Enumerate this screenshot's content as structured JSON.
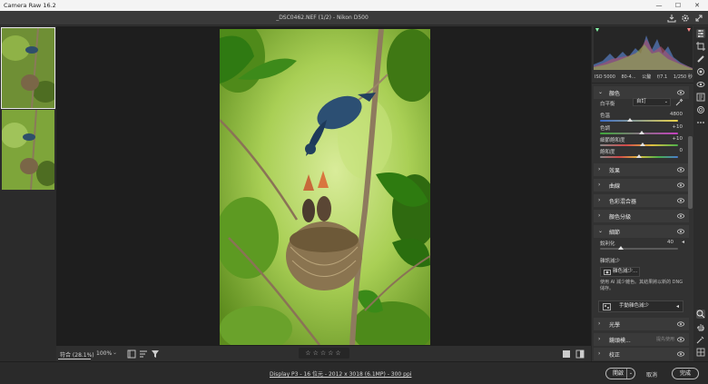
{
  "window": {
    "title": "Camera Raw 16.2",
    "minimize": "—",
    "maximize": "☐",
    "close": "✕"
  },
  "header": {
    "file_title": "_DSC0462.NEF (1/2)  -  Nikon D500"
  },
  "bottom_toolbar": {
    "zoom_fit": "符合 (28.1%)",
    "zoom_100": "100%",
    "zoom_caret": "⌄",
    "rating_stars": "☆☆☆☆☆"
  },
  "exif": {
    "iso": "ISO 5000",
    "lens": "80-4...",
    "focal": "公釐",
    "aperture": "f/7.1",
    "shutter": "1/250 秒"
  },
  "panels": {
    "color": {
      "title": "顏色",
      "white_balance_label": "白平衡",
      "white_balance_value": "自訂",
      "temperature_label": "色溫",
      "temperature_value": "4800",
      "temperature_level": 0.38,
      "tint_label": "色調",
      "tint_value": "+10",
      "tint_level": 0.53,
      "vibrance_label": "細節飽和度",
      "vibrance_value": "+10",
      "vibrance_level": 0.55,
      "saturation_label": "飽和度",
      "saturation_value": "0",
      "saturation_level": 0.5
    },
    "effects": {
      "title": "效果"
    },
    "curve": {
      "title": "曲線"
    },
    "color_mixer": {
      "title": "色彩混合器"
    },
    "color_grading": {
      "title": "顏色分級"
    },
    "detail": {
      "title": "細節",
      "sharpening_label": "銳利化",
      "sharpening_value": "40",
      "sharpening_level": 0.27,
      "noise_reduction_title": "雜訊減少",
      "denoise_button": "雜色減少...",
      "denoise_desc": "使用 AI 減少雜色。其結果將以新的 DNG 儲存。",
      "manual_nr_button": "手動雜色減少"
    },
    "optics": {
      "title": "光學"
    },
    "lens_blur": {
      "title": "鏡頭模...",
      "extra": "提先使用"
    },
    "calibration": {
      "title": "校正"
    }
  },
  "status": {
    "file_info": "Display P3 - 16 位元 - 2012 x 3018 (6.1MP) - 300 ppi"
  },
  "actions": {
    "open_label": "開啟",
    "open_split": "⌄",
    "cancel_label": "取消",
    "done_label": "完成"
  },
  "icons": {
    "panel_chevron_open": "⌄",
    "panel_chevron_closed": "›",
    "dropdown_caret": "⌄",
    "manual_nr_arrow": "◂"
  },
  "colors": {
    "panel_bg": "#323232",
    "canvas_bg": "#1e1e1e",
    "accent": "#ffffff"
  }
}
